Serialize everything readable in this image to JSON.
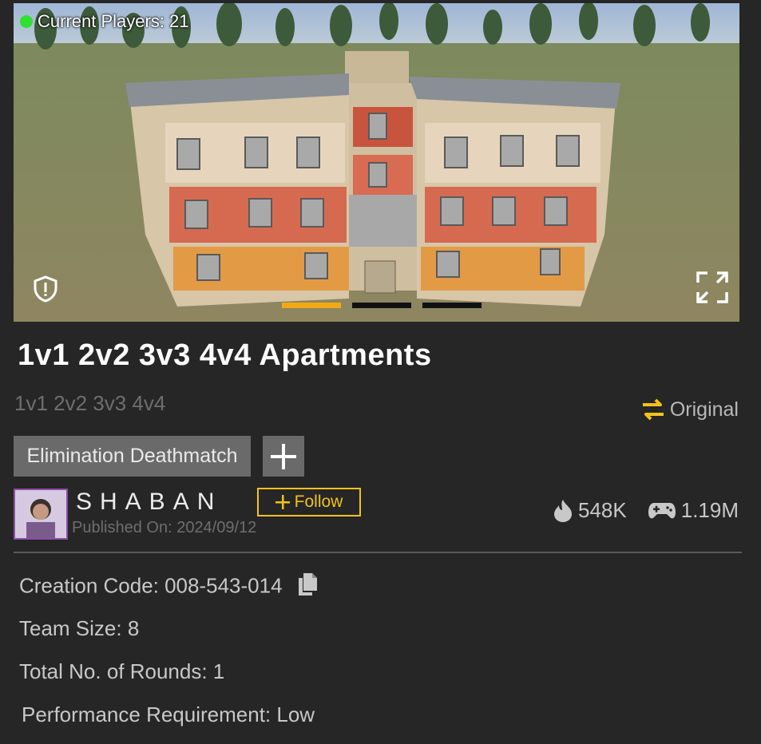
{
  "hero": {
    "players_label": "Current Players: 21",
    "carousel": {
      "count": 3,
      "active_index": 0
    },
    "icons": [
      "shield-alert-icon",
      "fullscreen-icon"
    ]
  },
  "map": {
    "title": "1v1 2v2 3v3 4v4 Apartments",
    "subtitle": "1v1 2v2 3v3 4v4",
    "original_label": "Original",
    "mode_tag": "Elimination Deathmatch"
  },
  "author": {
    "name": "SHABAN",
    "published": "Published On: 2024/09/12",
    "follow_label": "Follow"
  },
  "stats": {
    "heat": "548K",
    "plays": "1.19M"
  },
  "details": {
    "creation_code": "Creation Code: 008-543-014",
    "team_size": "Team Size: 8",
    "rounds": "Total No. of Rounds: 1",
    "performance": "Performance Requirement: Low"
  },
  "colors": {
    "accent_yellow": "#f2c21b",
    "progress_orange": "#f2a915",
    "online_green": "#2fe02f",
    "background": "#262626"
  }
}
